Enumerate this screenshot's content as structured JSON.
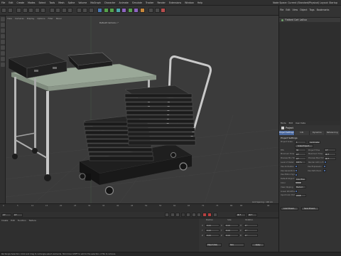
{
  "menubar": {
    "items": [
      "File",
      "Edit",
      "Create",
      "Modes",
      "Select",
      "Tools",
      "Mesh",
      "Spline",
      "Volume",
      "MoGraph",
      "Character",
      "Animate",
      "Simulate",
      "Tracker",
      "Render",
      "Extensions",
      "Window",
      "Help"
    ],
    "right": "Node Space:  Current (Standard/Physical)     Layout:  Startup"
  },
  "viewport": {
    "menu": [
      "View",
      "Cameras",
      "Display",
      "Options",
      "Filter",
      "Panel"
    ],
    "camera_label": "Default Camera •°",
    "grid_spacing": "Grid Spacing : 100 cm"
  },
  "objects": {
    "header": [
      "File",
      "Edit",
      "View",
      "Object",
      "Tags",
      "Bookmarks"
    ],
    "sub": [
      "Modes",
      "Edit",
      "User Data"
    ],
    "rows": [
      {
        "name": "Flatbed Cart Lalilux"
      }
    ]
  },
  "attributes": {
    "menu": [
      "Mode",
      "Edit",
      "User Data"
    ],
    "title": "Project",
    "tabs": [
      {
        "label": "Project Settings",
        "active": true
      },
      {
        "label": "Info",
        "active": false
      },
      {
        "label": "Dynamics",
        "active": false
      },
      {
        "label": "Referencing",
        "active": false
      }
    ],
    "tabs2": [
      "To Do",
      "Key Interpolation",
      "Scene Nodes"
    ],
    "section": "Project Settings",
    "project_scale_label": "Project Scale",
    "project_scale_value": "1",
    "project_scale_unit": "Centimeters",
    "scale_button": "Scale Project...",
    "rows": [
      {
        "l1": "FPS",
        "v1": "30",
        "l2": "Project Time",
        "v2": "0 F"
      },
      {
        "l1": "Minimum Time",
        "v1": "0 F",
        "l2": "Maximum Time",
        "v2": "90 F"
      },
      {
        "l1": "Preview Min Time",
        "v1": "0 F",
        "l2": "Preview Max Time",
        "v2": "90 F"
      },
      {
        "l1": "Level of Detail",
        "v1": "100 %",
        "l2": "Render LOD in Editor",
        "v2": ""
      }
    ],
    "checks": [
      {
        "l1": "Use Animation",
        "l2": "Use Expression"
      },
      {
        "l1": "Use Generators",
        "l2": "Use Deformers"
      },
      {
        "l1": "Use Motion System",
        "l2": ""
      }
    ],
    "default_object_color_label": "Default Object Color",
    "default_object_color_value": "Gray Blue",
    "color_label": "Color",
    "view_clipping_label": "View Clipping",
    "view_clipping_value": "Medium",
    "linear_workflow_label": "Linear Workflow",
    "input_color_profile_label": "Input Color Profile",
    "input_color_profile_value": "sRGB",
    "bottom_buttons": [
      "Load Preset...",
      "Save Preset..."
    ]
  },
  "timeline": {
    "ticks": [
      "0",
      "5",
      "10",
      "15",
      "20",
      "25",
      "30",
      "35",
      "40",
      "45",
      "50",
      "55",
      "60",
      "65",
      "70",
      "75",
      "80",
      "85",
      "90"
    ],
    "fps_label": "0 F",
    "frame_start": "0 F",
    "frame_current": "0 F",
    "frame_end": "90 F",
    "frame_max": "90 F"
  },
  "materials": {
    "menu": [
      "Create",
      "Edit",
      "Function",
      "Texture"
    ]
  },
  "coordinates": {
    "heads": [
      "Position",
      "Size",
      "Rotation"
    ],
    "rows": [
      {
        "a": "X",
        "av": "0 cm",
        "b": "X",
        "bv": "0 cm",
        "c": "H",
        "cv": "0 °"
      },
      {
        "a": "Y",
        "av": "0 cm",
        "b": "Y",
        "bv": "0 cm",
        "c": "P",
        "cv": "0 °"
      },
      {
        "a": "Z",
        "av": "0 cm",
        "b": "Z",
        "bv": "0 cm",
        "c": "B",
        "cv": "0 °"
      }
    ],
    "mode_left": "Object (Rel)",
    "mode_mid": "Size",
    "apply": "Apply"
  },
  "status": "Rectangle Selection: Click and drag to rectangle-select elements. Hold down SHIFT to add to the selection, CTRL to remove.",
  "colors": {
    "accent": "#4c6aa0",
    "viewport": "#3b3b3b",
    "table_top": "#9aa898"
  }
}
